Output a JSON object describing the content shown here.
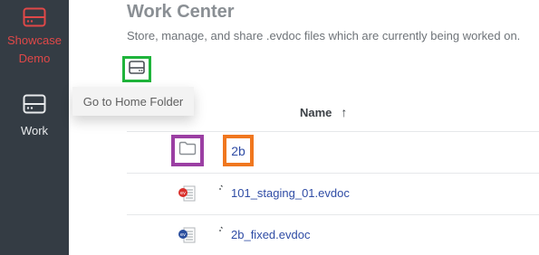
{
  "sidebar": {
    "items": [
      {
        "label_line1": "Showcase",
        "label_line2": "Demo",
        "icon": "drive-icon",
        "color": "#e04848"
      },
      {
        "label": "Work",
        "icon": "drive-icon",
        "color": "#e8eaec"
      }
    ]
  },
  "header": {
    "title": "Work Center",
    "subtitle": "Store, manage, and share .evdoc files which are currently being worked on."
  },
  "toolbar": {
    "home_icon": "drive-icon",
    "tooltip": "Go to Home Folder"
  },
  "table": {
    "columns": [
      {
        "label": "Name",
        "sort": "↑"
      }
    ],
    "rows": [
      {
        "type": "folder",
        "icon": "folder-icon",
        "name": "2b"
      },
      {
        "type": "file",
        "icon": "evdoc-red-icon",
        "status_icon": "loading-spinner-icon",
        "name": "101_staging_01.evdoc"
      },
      {
        "type": "file",
        "icon": "evdoc-blue-icon",
        "status_icon": "loading-spinner-icon",
        "name": "2b_fixed.evdoc"
      }
    ]
  },
  "colors": {
    "sidebar_bg": "#343c44",
    "accent_red": "#e04848",
    "link_blue": "#2f4ca5",
    "highlight_green": "#1fb43b",
    "highlight_purple": "#9b3fa3",
    "highlight_orange": "#f0771f"
  }
}
